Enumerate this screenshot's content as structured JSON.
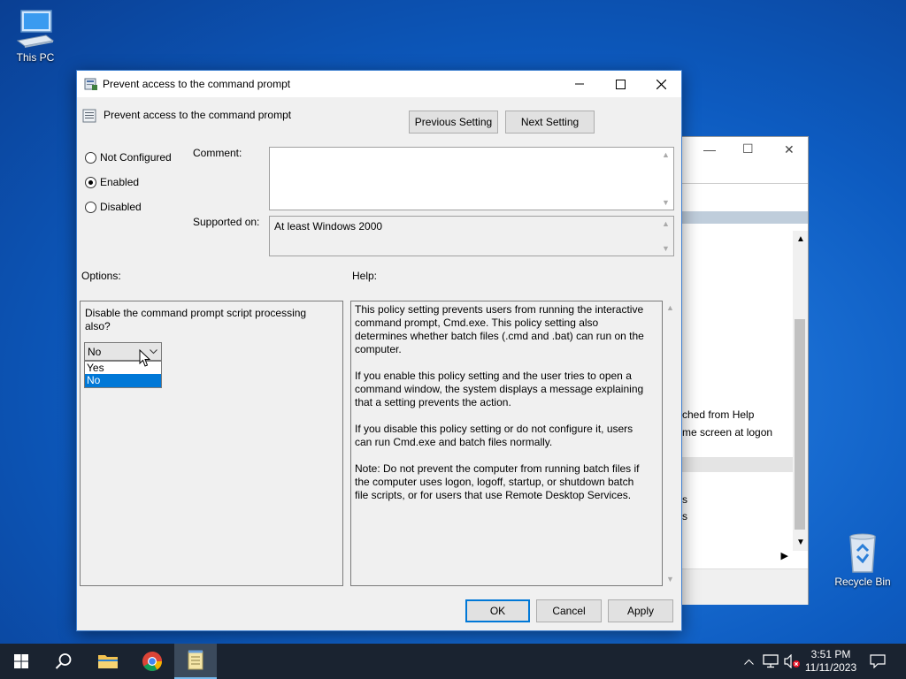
{
  "desktop": {
    "this_pc_label": "This PC",
    "recycle_bin_label": "Recycle Bin"
  },
  "bg_window": {
    "text_1": "ched from Help",
    "text_2": "me screen at logon",
    "text_3": "s",
    "text_4": "s"
  },
  "dialog": {
    "title": "Prevent access to the command prompt",
    "setting_name": "Prevent access to the command prompt",
    "previous_button": "Previous Setting",
    "next_button": "Next Setting",
    "radio_not_configured": "Not Configured",
    "radio_enabled": "Enabled",
    "radio_disabled": "Disabled",
    "selected_state": "Enabled",
    "comment_label": "Comment:",
    "comment_value": "",
    "supported_label": "Supported on:",
    "supported_value": "At least Windows 2000",
    "options_label": "Options:",
    "help_label": "Help:",
    "option_question": "Disable the command prompt script processing also?",
    "dropdown_value": "No",
    "dropdown_options": [
      "Yes",
      "No"
    ],
    "dropdown_highlighted": "No",
    "help_paragraphs": [
      "This policy setting prevents users from running the interactive command prompt, Cmd.exe.  This policy setting also determines whether batch files (.cmd and .bat) can run on the computer.",
      "If you enable this policy setting and the user tries to open a command window, the system displays a message explaining that a setting prevents the action.",
      "If you disable this policy setting or do not configure it, users can run Cmd.exe and batch files normally.",
      "Note: Do not prevent the computer from running batch files if the computer uses logon, logoff, startup, or shutdown batch file scripts, or for users that use Remote Desktop Services."
    ],
    "ok_button": "OK",
    "cancel_button": "Cancel",
    "apply_button": "Apply"
  },
  "taskbar": {
    "time": "3:51 PM",
    "date": "11/11/2023"
  },
  "colors": {
    "accent": "#0078d7",
    "taskbar": "#1a2330"
  }
}
